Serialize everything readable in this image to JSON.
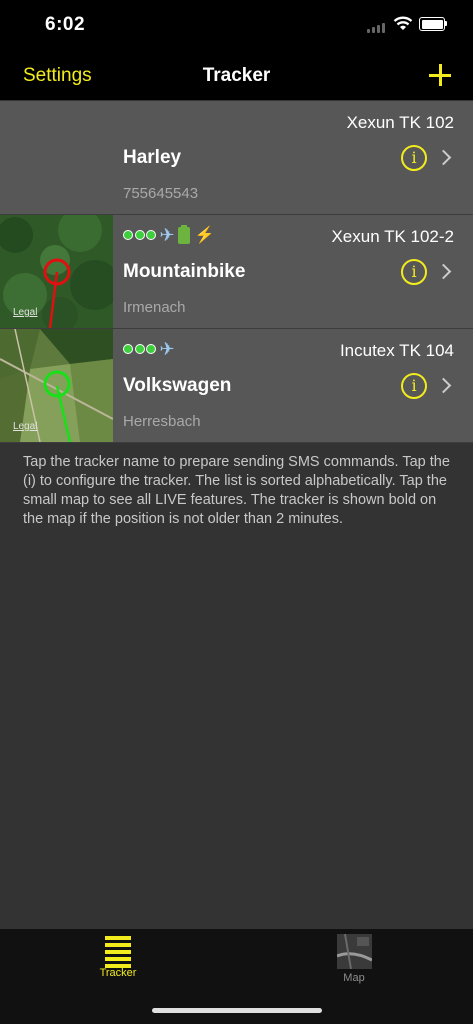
{
  "status_bar": {
    "time": "6:02"
  },
  "nav": {
    "left_label": "Settings",
    "title": "Tracker"
  },
  "trackers": [
    {
      "model": "Xexun TK 102",
      "name": "Harley",
      "subtitle": "755645543",
      "has_map": false,
      "status": []
    },
    {
      "model": "Xexun TK 102-2",
      "name": "Mountainbike",
      "subtitle": "Irmenach",
      "has_map": true,
      "map_label": "Legal",
      "marker_color": "#e01010",
      "status": [
        "dot",
        "dot",
        "dot",
        "airplane",
        "battery",
        "bolt"
      ]
    },
    {
      "model": "Incutex TK 104",
      "name": "Volkswagen",
      "subtitle": "Herresbach",
      "has_map": true,
      "map_label": "Legal",
      "marker_color": "#18e018",
      "status": [
        "dot",
        "dot",
        "dot",
        "airplane"
      ]
    }
  ],
  "help_text": "Tap the tracker name to prepare sending SMS commands. Tap the (i) to configure the tracker. The list is sorted alphabetically. Tap the small map to see all LIVE features. The tracker is shown bold on the map if the position is not older than 2 minutes.",
  "tabs": [
    {
      "label": "Tracker",
      "icon": "list-lines-icon",
      "active": true,
      "color": "#f3ec1d"
    },
    {
      "label": "Map",
      "icon": "map-icon",
      "active": false,
      "color": "#8e8e8e"
    }
  ],
  "colors": {
    "accent": "#f3ec1d",
    "row_bg": "#575757",
    "background": "#333333"
  }
}
